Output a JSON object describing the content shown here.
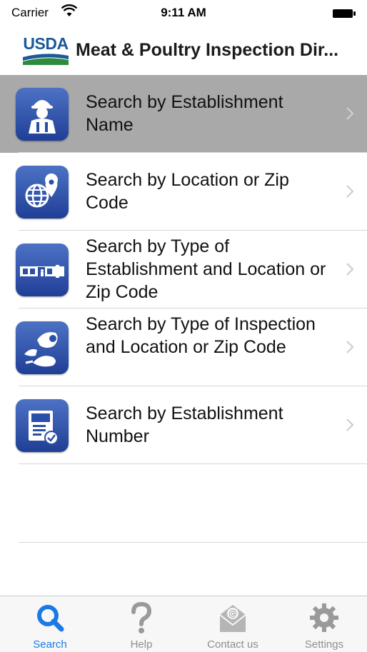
{
  "status_bar": {
    "carrier": "Carrier",
    "time": "9:11 AM"
  },
  "nav": {
    "logo_text": "USDA",
    "title": "Meat & Poultry Inspection Dir..."
  },
  "menu": {
    "items": [
      {
        "label": "Search by Establishment Name",
        "icon": "inspector-icon",
        "selected": true
      },
      {
        "label": "Search by Location or Zip Code",
        "icon": "globe-location-icon",
        "selected": false
      },
      {
        "label": "Search by Type of Establishment and Location or Zip Code",
        "icon": "establishment-building-icon",
        "selected": false
      },
      {
        "label": "Search by Type of Inspection and Location or Zip Code",
        "icon": "meat-poultry-icon",
        "selected": false
      },
      {
        "label": "Search by Establishment Number",
        "icon": "establishment-number-icon",
        "selected": false
      }
    ]
  },
  "tabs": [
    {
      "label": "Search",
      "icon": "search-icon",
      "active": true
    },
    {
      "label": "Help",
      "icon": "question-mark-icon",
      "active": false
    },
    {
      "label": "Contact us",
      "icon": "envelope-at-icon",
      "active": false
    },
    {
      "label": "Settings",
      "icon": "gear-icon",
      "active": false
    }
  ],
  "colors": {
    "active_tab": "#1a7ae6",
    "icon_blue": "#2a4fa8",
    "selected_row": "#a9a9a9"
  }
}
